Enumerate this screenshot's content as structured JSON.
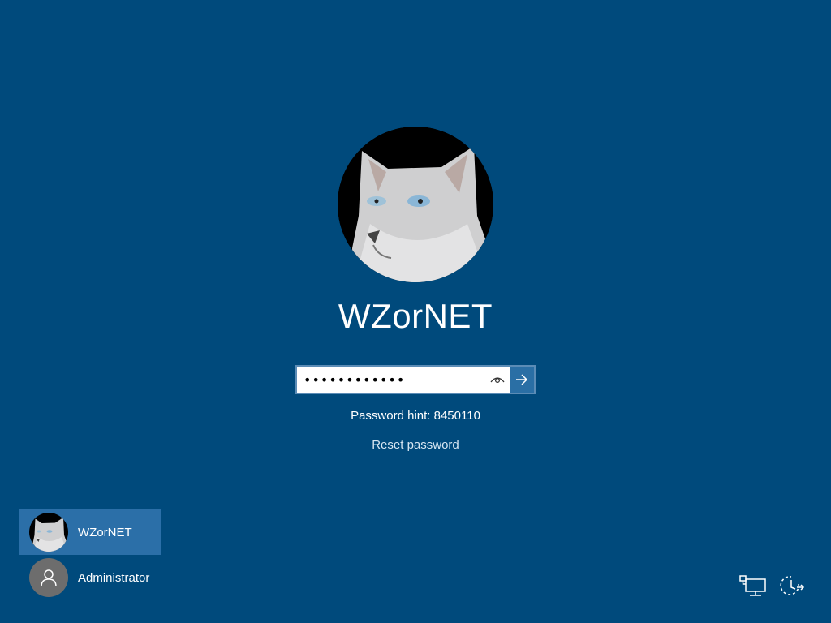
{
  "current_user": {
    "name": "WZorNET"
  },
  "password": {
    "value": "••••••••••••",
    "hint_text": "Password hint: 8450110"
  },
  "reset_password_label": "Reset password",
  "users": [
    {
      "name": "WZorNET",
      "selected": true,
      "avatar": "cat-photo"
    },
    {
      "name": "Administrator",
      "selected": false,
      "avatar": "person-icon"
    }
  ],
  "icons": {
    "reveal": "eye-icon",
    "submit": "arrow-right-icon",
    "network": "network-icon",
    "power": "power-icon"
  },
  "colors": {
    "background": "#004a7c",
    "selected_user": "#2b6fa8",
    "submit_button": "#2a6fa5"
  }
}
